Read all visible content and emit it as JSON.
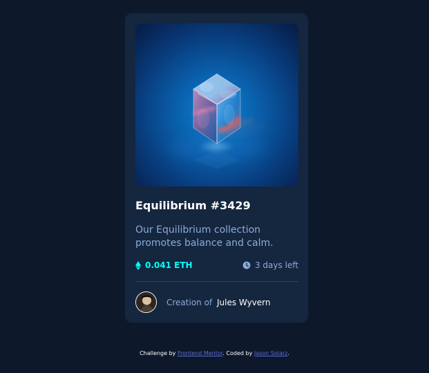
{
  "card": {
    "title": "Equilibrium #3429",
    "description": "Our Equilibrium collection promotes balance and calm.",
    "price": "0.041 ETH",
    "time_left": "3 days left",
    "creator_prefix": "Creation of",
    "creator_name": "Jules Wyvern"
  },
  "attribution": {
    "prefix": "Challenge by",
    "challenge_link": "Frontend Mentor",
    "middle": ". Coded by",
    "author_link": "Jason Solarz",
    "suffix": "."
  },
  "icons": {
    "price": "ethereum-icon",
    "time": "clock-icon"
  },
  "colors": {
    "background": "#0d192b",
    "card": "#15263f",
    "accent": "#00fff8",
    "muted": "#8bacd9"
  }
}
